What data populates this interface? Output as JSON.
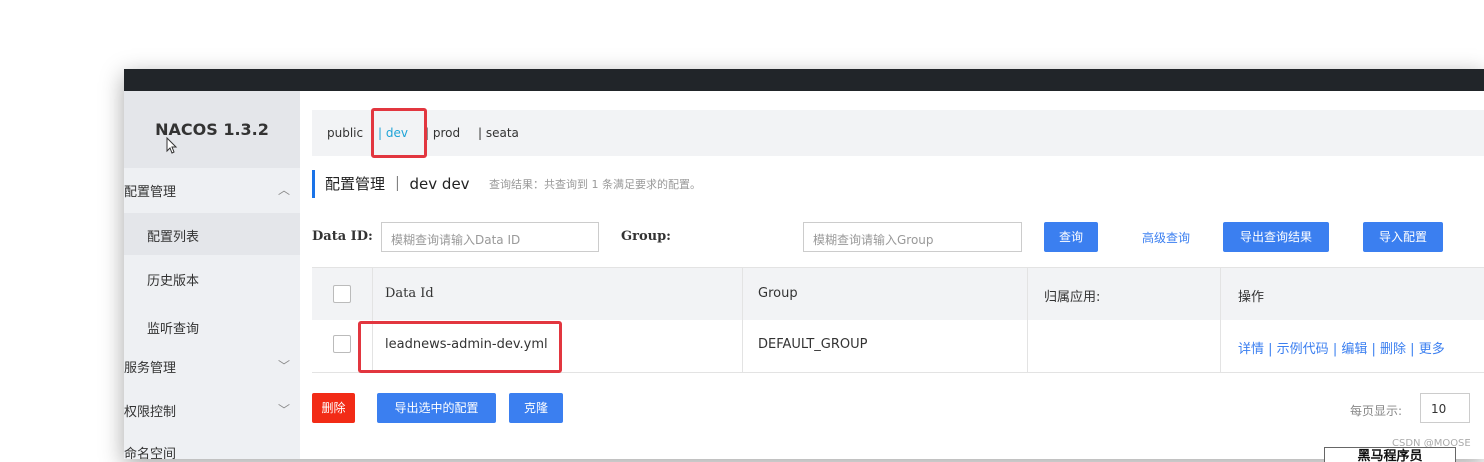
{
  "app": {
    "brand": "NACOS 1.3.2"
  },
  "sidebar": {
    "config_menu": "配置管理",
    "config_items": [
      "配置列表",
      "历史版本",
      "监听查询"
    ],
    "service_menu": "服务管理",
    "auth_menu": "权限控制",
    "namespace_menu": "命名空间"
  },
  "namespaces": {
    "items": [
      "public",
      "| dev",
      "| prod",
      "| seata"
    ],
    "active": "dev"
  },
  "page": {
    "title": "配置管理 ｜ dev  dev",
    "result": "查询结果：共查询到 1 条满足要求的配置。"
  },
  "search": {
    "dataid_label": "Data ID:",
    "dataid_placeholder": "模糊查询请输入Data ID",
    "group_label": "Group:",
    "group_placeholder": "模糊查询请输入Group",
    "query_button": "查询",
    "advanced_link": "高级查询",
    "export_results_button": "导出查询结果",
    "import_button": "导入配置"
  },
  "table": {
    "columns": [
      "Data Id",
      "Group",
      "归属应用:",
      "操作"
    ],
    "rows": [
      {
        "data_id": "leadnews-admin-dev.yml",
        "group": "DEFAULT_GROUP",
        "app": ""
      }
    ],
    "actions": [
      "详情",
      "示例代码",
      "编辑",
      "删除",
      "更多"
    ]
  },
  "footer": {
    "delete_button": "删除",
    "export_selected_button": "导出选中的配置",
    "clone_button": "克隆",
    "page_size_label": "每页显示:",
    "page_size": "10"
  },
  "watermark": "CSDN @MOOSE",
  "stamp": "黑马程序员",
  "colors": {
    "accent": "#3b7ff0",
    "danger": "#f22b16",
    "highlight_box": "#e2363f",
    "topbar": "#212529"
  }
}
